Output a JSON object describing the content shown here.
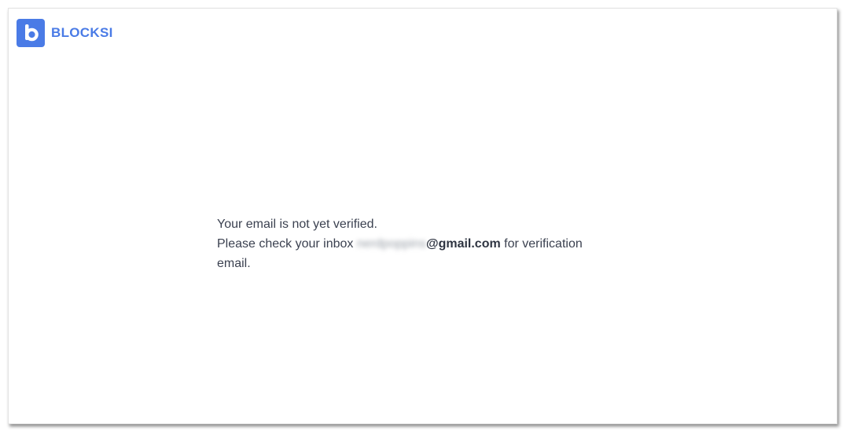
{
  "brand": {
    "name": "BLOCKSI",
    "logo_letter": "b",
    "color": "#4a7be6"
  },
  "message": {
    "line1": "Your email is not yet verified.",
    "line2_prefix": "Please check your inbox",
    "email_local_blurred": "nerdpoppins",
    "email_domain": "@gmail.com",
    "line2_suffix": "for verification",
    "line3": "email."
  },
  "colors": {
    "text": "#3b4150",
    "accent": "#4a7be6"
  }
}
